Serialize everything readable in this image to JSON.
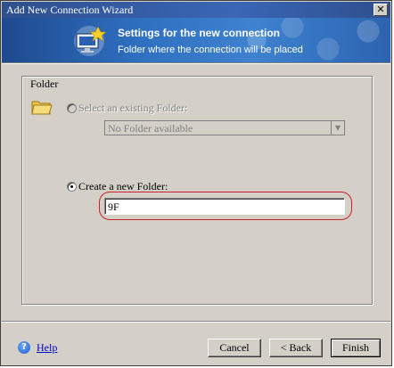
{
  "window": {
    "title": "Add New Connection Wizard",
    "close_glyph": "✕"
  },
  "header": {
    "title": "Settings for the new connection",
    "subtitle": "Folder where the connection will be placed",
    "icon": "wizard-monitor-icon"
  },
  "folder_group": {
    "legend": "Folder",
    "icon": "folder-open-icon",
    "existing": {
      "label": "Select an existing Folder:",
      "selected": false,
      "enabled": false,
      "dropdown_value": "No Folder available"
    },
    "new": {
      "label": "Create a new Folder:",
      "selected": true,
      "value": "9F"
    }
  },
  "footer": {
    "help_label": "Help",
    "buttons": {
      "cancel": "Cancel",
      "back": "< Back",
      "finish": "Finish"
    }
  },
  "colors": {
    "annotation_circle": "#c8202a",
    "banner": "#2f6fc0"
  }
}
